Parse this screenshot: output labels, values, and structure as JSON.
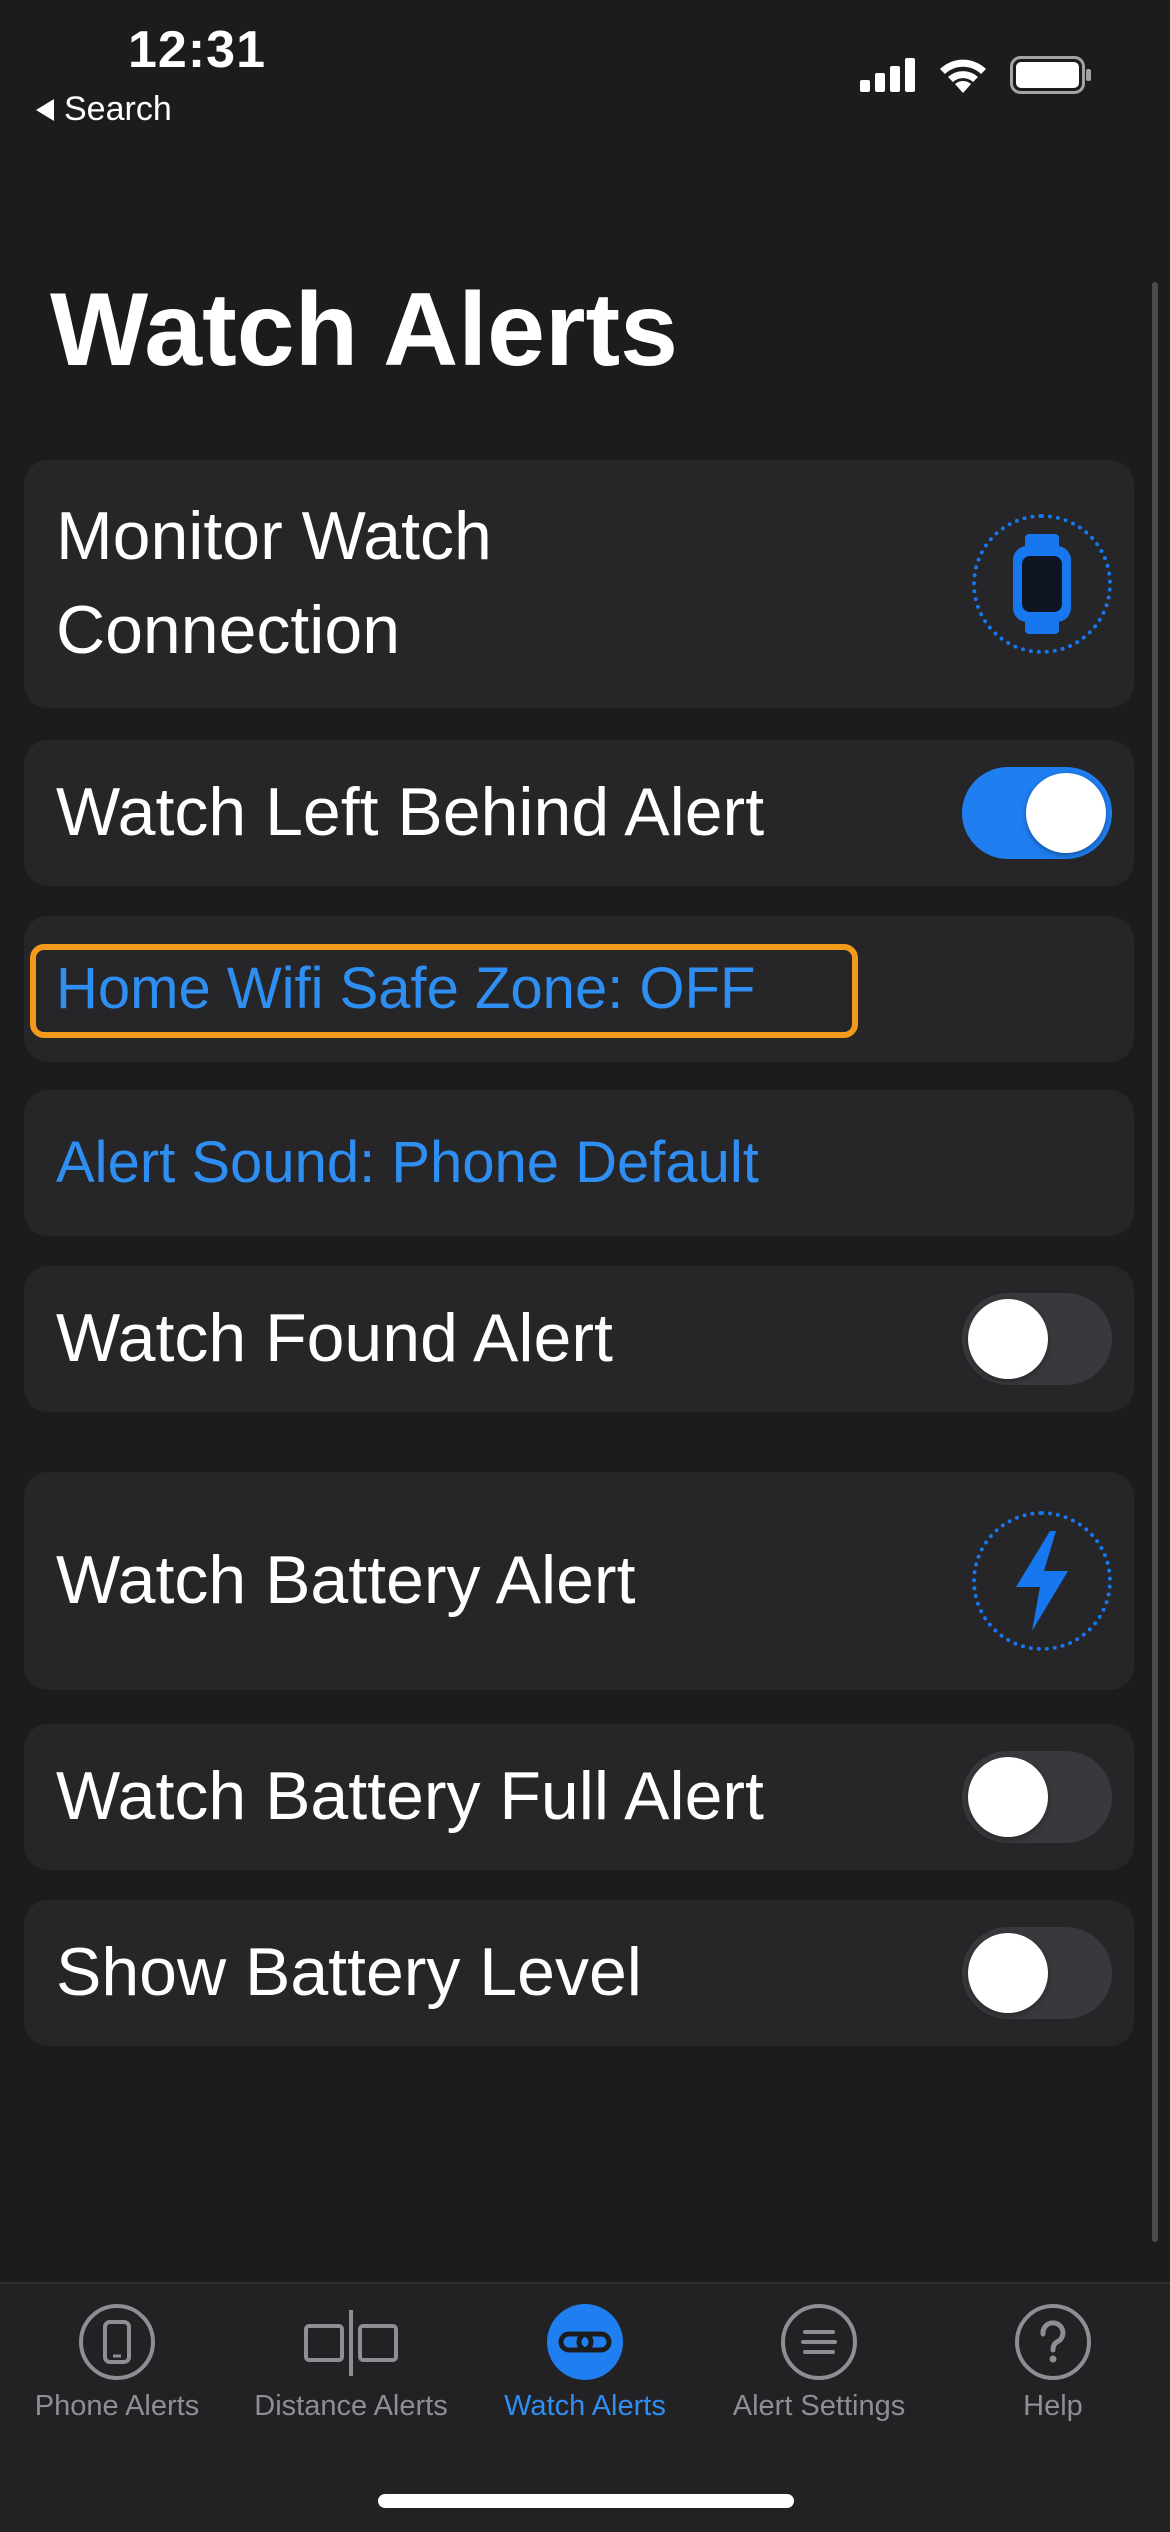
{
  "status_bar": {
    "time": "12:31",
    "back_label": "Search"
  },
  "page": {
    "title": "Watch Alerts"
  },
  "cells": {
    "monitor": {
      "label_line1": "Monitor Watch",
      "label_line2": "Connection",
      "icon": "watch-icon"
    },
    "left_behind": {
      "label": "Watch Left Behind Alert",
      "toggle_on": true
    },
    "home_wifi": {
      "label": "Home Wifi Safe Zone: OFF"
    },
    "alert_sound": {
      "label": "Alert Sound: Phone Default"
    },
    "watch_found": {
      "label": "Watch Found Alert",
      "toggle_on": false
    },
    "battery": {
      "label": "Watch Battery Alert",
      "icon": "lightning-icon"
    },
    "battery_full": {
      "label": "Watch Battery Full Alert",
      "toggle_on": false
    },
    "battery_level": {
      "label": "Show Battery Level",
      "toggle_on": false
    }
  },
  "tabbar": {
    "tabs": [
      {
        "label": "Phone Alerts",
        "icon": "phone-icon",
        "active": false
      },
      {
        "label": "Distance Alerts",
        "icon": "distance-icon",
        "active": false
      },
      {
        "label": "Watch Alerts",
        "icon": "link-icon",
        "active": true
      },
      {
        "label": "Alert Settings",
        "icon": "list-icon",
        "active": false
      },
      {
        "label": "Help",
        "icon": "help-icon",
        "active": false
      }
    ]
  },
  "colors": {
    "background": "#1c1c1e",
    "cell": "#262628",
    "accent": "#1f7ef0",
    "link": "#2f8ef2",
    "highlight": "#f39a1a"
  }
}
